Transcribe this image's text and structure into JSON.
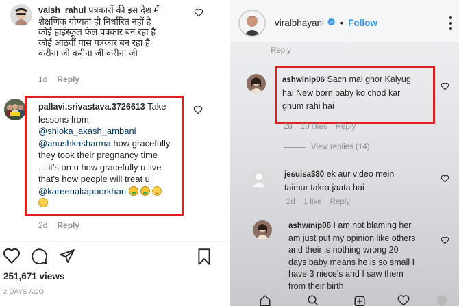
{
  "left": {
    "comment1": {
      "username": "vaish_rahul",
      "lines": [
        "पत्रकारों की इस देश में",
        "शैक्षणिक योग्यता ही निर्धारित नहीं है",
        "कोई हाईस्कूल फेल पत्रकार बन रहा है",
        "कोई आठवीं पास पत्रकार बन रहा है",
        "करीना जी करीना जी करीना जी"
      ],
      "age": "1d",
      "reply": "Reply"
    },
    "comment2": {
      "username": "pallavi.srivastava.3726613",
      "first_line_rest": "Take",
      "line2": "lessons from",
      "mention1": "@shloka_akash_ambani",
      "mention2": "@anushkasharma",
      "line4_rest": "how gracefully",
      "line5": "they took their pregnancy time",
      "line6": "....it's on u how gracefully u live",
      "line7": "that's how people will treat u",
      "mention3": "@kareenakapoorkhan",
      "age": "2d",
      "reply": "Reply"
    },
    "views": "251,671 views",
    "date": "2 DAYS AGO",
    "colors": {
      "highlight": "#e02020",
      "mention": "#00376b",
      "muted": "#8e8e8e"
    }
  },
  "right": {
    "header": {
      "username": "viralbhayani",
      "separator": "•",
      "follow": "Follow"
    },
    "top_reply": "Reply",
    "comment1": {
      "username": "ashwinip06",
      "first_line_rest": "Sach mai ghor Kalyug",
      "line2": "hai New born baby ko chod kar",
      "line3": "ghum rahi hai",
      "age": "2d",
      "likes": "10 likes",
      "reply": "Reply",
      "view_replies": "View replies (14)"
    },
    "comment2": {
      "username": "jesuisa380",
      "first_line_rest": "ek aur video mein",
      "line2": "taimur takra jaata hai",
      "age": "2d",
      "likes": "1 like",
      "reply": "Reply"
    },
    "comment3": {
      "username": "ashwinip06",
      "first_line_rest": "I am not blaming her",
      "lines": [
        "am just put my opinion like others",
        "and their is nothing wrong 20",
        "days baby means he is so small I",
        "have 3 niece's and I saw them",
        "from their birth"
      ]
    }
  }
}
